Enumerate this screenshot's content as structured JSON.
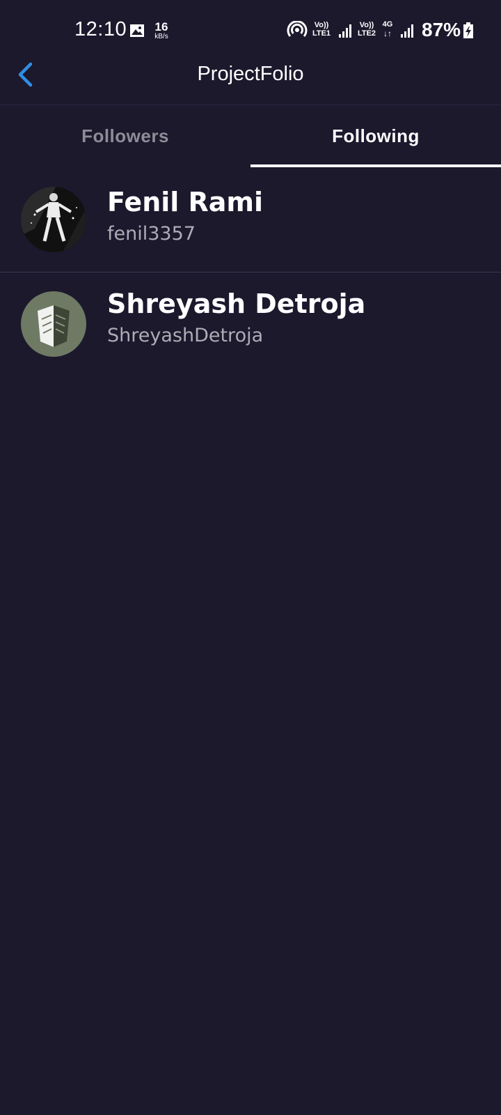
{
  "status_bar": {
    "time": "12:10",
    "speed_value": "16",
    "speed_unit": "kB/s",
    "sim1_top": "Vo))",
    "sim1_bottom": "LTE1",
    "sim2_top": "Vo))",
    "sim2_bottom": "LTE2",
    "network_type": "4G",
    "network_arrows": "↓↑",
    "battery": "87%"
  },
  "header": {
    "title": "ProjectFolio",
    "back_icon": "chevron-left-icon",
    "accent_color": "#2f8fe6"
  },
  "tabs": [
    {
      "label": "Followers",
      "active": false
    },
    {
      "label": "Following",
      "active": true
    }
  ],
  "users": [
    {
      "name": "Fenil Rami",
      "handle": "fenil3357"
    },
    {
      "name": "Shreyash Detroja",
      "handle": "ShreyashDetroja"
    }
  ],
  "colors": {
    "background": "#1c192d",
    "text_primary": "#ffffff",
    "text_secondary": "#aeacb6",
    "tab_inactive": "#8e8c97"
  }
}
